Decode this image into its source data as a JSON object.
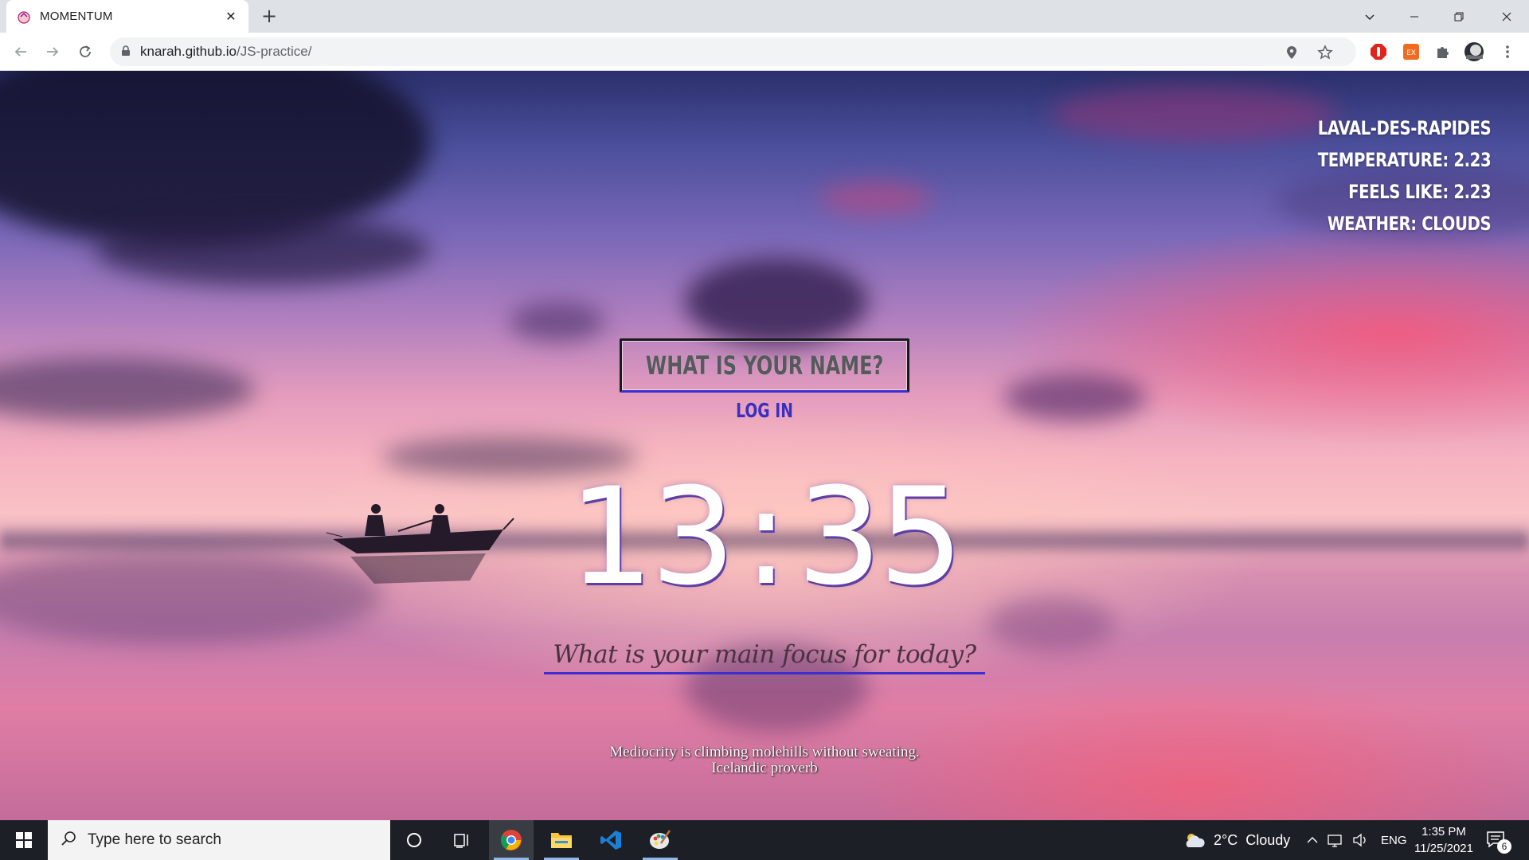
{
  "browser": {
    "tab_title": "MOMENTUM",
    "tab_close": "✕",
    "new_tab": "+",
    "url_host": "knarah.github.io",
    "url_path": "/JS-practice/"
  },
  "weather": {
    "city": "LAVAL-DES-RAPIDES",
    "temperature": "TEMPERATURE: 2.23",
    "feels_like": "FEELS LIKE: 2.23",
    "condition": "WEATHER: CLOUDS"
  },
  "login": {
    "placeholder": "WHAT IS YOUR NAME?",
    "button_label": "LOG IN"
  },
  "clock": {
    "hours": "13",
    "separator": ":",
    "minutes": "35"
  },
  "focus": {
    "prompt": "What is your main focus for today?"
  },
  "quote": {
    "text": "Mediocrity is climbing molehills without sweating.",
    "author": "Icelandic proverb"
  },
  "taskbar": {
    "search_placeholder": "Type here to search",
    "weather_text": "2°C  Cloudy",
    "language": "ENG",
    "time": "1:35 PM",
    "date": "11/25/2021",
    "notification_count": "6"
  },
  "colors": {
    "accent_underline": "#3e2ed0",
    "login_text": "#3b2fc0"
  }
}
